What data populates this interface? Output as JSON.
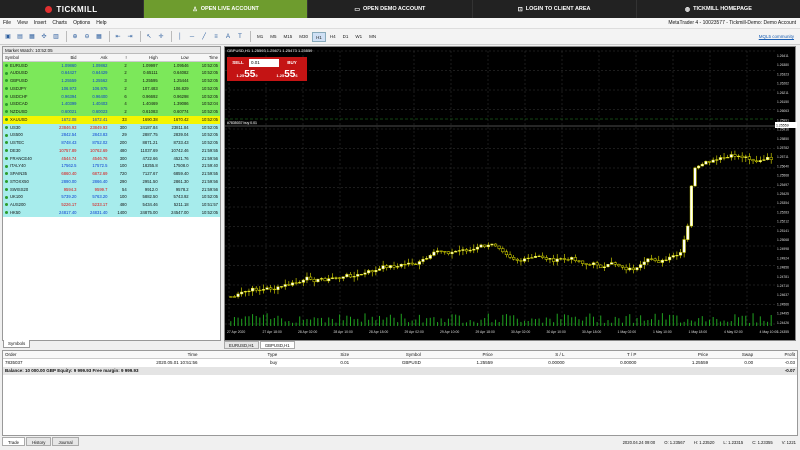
{
  "brand": {
    "name": "TICKMILL"
  },
  "topnav": [
    {
      "label": "OPEN LIVE ACCOUNT",
      "icon": "user-icon"
    },
    {
      "label": "OPEN DEMO ACCOUNT",
      "icon": "monitor-icon"
    },
    {
      "label": "LOGIN TO CLIENT AREA",
      "icon": "lock-icon"
    },
    {
      "label": "TICKMILL HOMEPAGE",
      "icon": "globe-icon"
    }
  ],
  "menu": [
    "File",
    "View",
    "Insert",
    "Charts",
    "Options",
    "Help"
  ],
  "window_title": "MetaTrader 4 - 10023577 - Tickmill-Demo: Demo Account",
  "timeframes": [
    "M1",
    "M5",
    "M15",
    "M30",
    "H1",
    "H4",
    "D1",
    "W1",
    "MN"
  ],
  "selected_timeframe": "H1",
  "community_link": "MQL5 community",
  "market_watch": {
    "title": "Market Watch: 10:52:05",
    "columns": [
      "Symbol",
      "Bid",
      "Ask",
      "!",
      "High",
      "Low",
      "Time"
    ],
    "rows": [
      {
        "s": "EURUSD",
        "bid": "1.09860",
        "ask": "1.09862",
        "sp": "2",
        "hi": "1.09997",
        "lo": "1.09546",
        "t": "10:52:05",
        "st": "g"
      },
      {
        "s": "AUDUSD",
        "bid": "0.64427",
        "ask": "0.64429",
        "sp": "2",
        "hi": "0.65111",
        "lo": "0.64082",
        "t": "10:52:05",
        "st": "g"
      },
      {
        "s": "GBPUSD",
        "bid": "1.25559",
        "ask": "1.25562",
        "sp": "3",
        "hi": "1.25595",
        "lo": "1.25444",
        "t": "10:52:05",
        "st": "g"
      },
      {
        "s": "USDJPY",
        "bid": "106.973",
        "ask": "106.975",
        "sp": "2",
        "hi": "107.483",
        "lo": "106.829",
        "t": "10:52:05",
        "st": "g"
      },
      {
        "s": "USDCHF",
        "bid": "0.96394",
        "ask": "0.96400",
        "sp": "6",
        "hi": "0.96692",
        "lo": "0.96298",
        "t": "10:52:05",
        "st": "g"
      },
      {
        "s": "USDCAD",
        "bid": "1.40399",
        "ask": "1.40403",
        "sp": "4",
        "hi": "1.40469",
        "lo": "1.39086",
        "t": "10:52:04",
        "st": "g"
      },
      {
        "s": "NZDUSD",
        "bid": "0.60021",
        "ask": "0.60023",
        "sp": "2",
        "hi": "0.61083",
        "lo": "0.60774",
        "t": "10:52:05",
        "st": "g"
      },
      {
        "s": "XAUUSD",
        "bid": "1672.08",
        "ask": "1672.41",
        "sp": "33",
        "hi": "1690.38",
        "lo": "1670.42",
        "t": "10:52:05",
        "st": "y"
      },
      {
        "s": "US30",
        "bid": "23846.93",
        "ask": "23849.93",
        "sp": "300",
        "hi": "24187.84",
        "lo": "23811.84",
        "t": "10:52:05",
        "st": "c"
      },
      {
        "s": "US500",
        "bid": "2842.54",
        "ask": "2843.83",
        "sp": "29",
        "hi": "2887.75",
        "lo": "2839.04",
        "t": "10:52:05",
        "st": "c"
      },
      {
        "s": "USTEC",
        "bid": "8748.43",
        "ask": "8752.02",
        "sp": "200",
        "hi": "8871.21",
        "lo": "8733.43",
        "t": "10:52:05",
        "st": "c"
      },
      {
        "s": "DE30",
        "bid": "10757.89",
        "ask": "10762.69",
        "sp": "480",
        "hi": "11037.69",
        "lo": "10742.46",
        "t": "21:59:55",
        "st": "c"
      },
      {
        "s": "FRANCE40",
        "bid": "4544.74",
        "ask": "4546.76",
        "sp": "300",
        "hi": "4722.66",
        "lo": "4521.76",
        "t": "21:59:56",
        "st": "c"
      },
      {
        "s": "ITALY40",
        "bid": "17562.5",
        "ask": "17572.5",
        "sp": "100",
        "hi": "18255.8",
        "lo": "17508.0",
        "t": "21:59:40",
        "st": "c"
      },
      {
        "s": "SPAIN35",
        "bid": "6860.40",
        "ask": "6872.69",
        "sp": "720",
        "hi": "7127.67",
        "lo": "6859.40",
        "t": "21:59:55",
        "st": "c"
      },
      {
        "s": "STOXX50",
        "bid": "2890.00",
        "ask": "2866.40",
        "sp": "290",
        "hi": "2951.50",
        "lo": "2861.30",
        "t": "21:59:56",
        "st": "c"
      },
      {
        "s": "SWISS20",
        "bid": "9594.3",
        "ask": "9599.7",
        "sp": "54",
        "hi": "9912.0",
        "lo": "9578.2",
        "t": "21:59:56",
        "st": "c"
      },
      {
        "s": "UK100",
        "bid": "5739.20",
        "ask": "5763.20",
        "sp": "100",
        "hi": "5882.50",
        "lo": "5743.92",
        "t": "10:52:05",
        "st": "c"
      },
      {
        "s": "AUS200",
        "bid": "5226.17",
        "ask": "5233.17",
        "sp": "480",
        "hi": "5434.46",
        "lo": "5211.18",
        "t": "10:51:57",
        "st": "c"
      },
      {
        "s": "HK50",
        "bid": "24817.40",
        "ask": "24831.40",
        "sp": "1400",
        "hi": "24875.00",
        "lo": "24547.00",
        "t": "10:52:05",
        "st": "c"
      }
    ],
    "footer_tab": "Symbols"
  },
  "chart": {
    "info": "GBPUSD,H1  1.25593 1.25671 1.25473 1.25559",
    "sell_label": "SELL",
    "buy_label": "BUY",
    "lot": "0.01",
    "sell_price_small": "1.25",
    "sell_price_big": "55",
    "sell_price_sup": "9",
    "buy_price_small": "1.25",
    "buy_price_big": "55",
    "buy_price_sup": "6",
    "order_label": "#7835037 buy 0.01",
    "y_ticks": [
      "1.26411",
      "1.26380",
      "1.26323",
      "1.26262",
      "1.26211",
      "1.26150",
      "1.26063",
      "1.25991",
      "1.25916",
      "1.25850",
      "1.25782",
      "1.25711",
      "1.25640",
      "1.25568",
      "1.25497",
      "1.25425",
      "1.25354",
      "1.25283",
      "1.25212",
      "1.25141",
      "1.25068",
      "1.24998",
      "1.24924",
      "1.24856",
      "1.24781",
      "1.24710",
      "1.24637",
      "1.24566",
      "1.24495",
      "1.24426",
      "1.24355"
    ],
    "x_ticks": [
      "27 Apr 2020",
      "27 Apr 18:00",
      "28 Apr 02:00",
      "28 Apr 10:00",
      "28 Apr 18:00",
      "29 Apr 02:00",
      "29 Apr 10:00",
      "29 Apr 18:00",
      "30 Apr 02:00",
      "30 Apr 10:00",
      "30 Apr 18:00",
      "1 May 02:00",
      "1 May 10:00",
      "1 May 18:00",
      "4 May 02:00",
      "4 May 10:00"
    ],
    "bid_price": "1.25559",
    "ask_price": "1.25562"
  },
  "chart_tabs": [
    "EURUSD,H1",
    "GBPUSD,H1"
  ],
  "terminal": {
    "columns": [
      "Order",
      "Time",
      "Type",
      "Size",
      "Symbol",
      "Price",
      "S / L",
      "T / P",
      "Price",
      "Swap",
      "Profit"
    ],
    "row": [
      "7835037",
      "2020.05.01 10:51:56",
      "buy",
      "0.01",
      "GBPUSD",
      "1.25559",
      "0.00000",
      "0.00000",
      "1.25559",
      "0.00",
      "-0.03"
    ],
    "balance": "Balance: 10 000.00 GBP  Equity: 9 999.93  Free margin: 9 999.93",
    "balance_profit": "-0.07"
  },
  "bottom_tabs": [
    "Trade",
    "History",
    "Journal"
  ],
  "status": [
    "2020.04.24 09:00",
    "O: 1.23567",
    "H: 1.23520",
    "L: 1.23315",
    "C: 1.23355",
    "V: 1221"
  ]
}
